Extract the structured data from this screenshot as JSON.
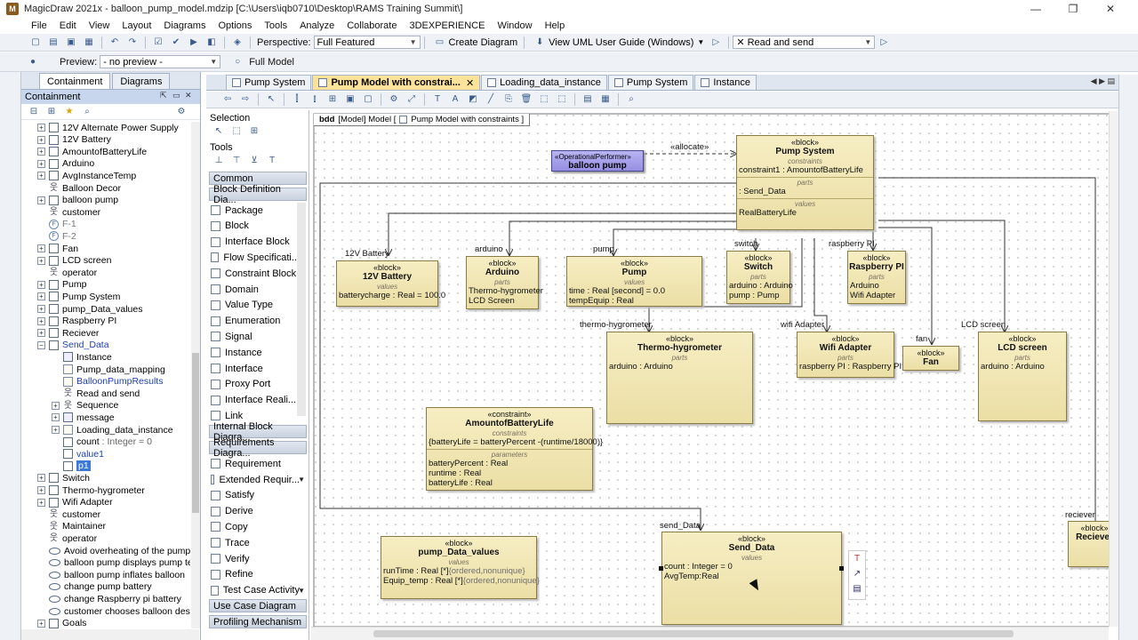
{
  "window": {
    "title": "MagicDraw 2021x - balloon_pump_model.mdzip [C:\\Users\\iqb0710\\Desktop\\RAMS Training Summit\\]",
    "app_icon": "M",
    "controls": [
      "—",
      "❐",
      "✕"
    ]
  },
  "menu": [
    "File",
    "Edit",
    "View",
    "Layout",
    "Diagrams",
    "Options",
    "Tools",
    "Analyze",
    "Collaborate",
    "3DEXPERIENCE",
    "Window",
    "Help"
  ],
  "toolbar": {
    "perspective_label": "Perspective:",
    "perspective_value": "Full Featured",
    "create_diagram": "Create Diagram",
    "uml_guide": "View UML User Guide (Windows)",
    "read_and_send": "Read and send",
    "preview_label": "Preview:",
    "preview_value": "- no preview -",
    "full_model": "Full Model"
  },
  "left_panel": {
    "tabs": [
      "Containment",
      "Diagrams"
    ],
    "header": "Containment",
    "tree": [
      {
        "label": "12V Alternate Power Supply",
        "indent": 1,
        "icon": "block",
        "exp": "+"
      },
      {
        "label": "12V Battery",
        "indent": 1,
        "icon": "block",
        "exp": "+"
      },
      {
        "label": "AmountofBatteryLife",
        "indent": 1,
        "icon": "block",
        "exp": "+"
      },
      {
        "label": "Arduino",
        "indent": 1,
        "icon": "block",
        "exp": "+"
      },
      {
        "label": "AvgInstanceTemp",
        "indent": 1,
        "icon": "block",
        "exp": "+"
      },
      {
        "label": "Balloon Decor",
        "indent": 1,
        "icon": "actor",
        "exp": ""
      },
      {
        "label": "balloon pump",
        "indent": 1,
        "icon": "block",
        "exp": "+"
      },
      {
        "label": "customer",
        "indent": 1,
        "icon": "actor",
        "exp": ""
      },
      {
        "label": "F-1",
        "indent": 1,
        "icon": "fn",
        "exp": "",
        "gray": true
      },
      {
        "label": "F-2",
        "indent": 1,
        "icon": "fn",
        "exp": "",
        "gray": true
      },
      {
        "label": "Fan",
        "indent": 1,
        "icon": "block",
        "exp": "+"
      },
      {
        "label": "LCD screen",
        "indent": 1,
        "icon": "block",
        "exp": "+"
      },
      {
        "label": "operator",
        "indent": 1,
        "icon": "actor",
        "exp": ""
      },
      {
        "label": "Pump",
        "indent": 1,
        "icon": "block",
        "exp": "+"
      },
      {
        "label": "Pump System",
        "indent": 1,
        "icon": "block",
        "exp": "+"
      },
      {
        "label": "pump_Data_values",
        "indent": 1,
        "icon": "block",
        "exp": "+"
      },
      {
        "label": "Raspberry PI",
        "indent": 1,
        "icon": "block",
        "exp": "+"
      },
      {
        "label": "Reciever",
        "indent": 1,
        "icon": "block",
        "exp": "+"
      },
      {
        "label": "Send_Data",
        "indent": 1,
        "icon": "block",
        "exp": "−",
        "link": true
      },
      {
        "label": "Instance",
        "indent": 2,
        "icon": "inst",
        "exp": ""
      },
      {
        "label": "Pump_data_mapping",
        "indent": 2,
        "icon": "diag",
        "exp": ""
      },
      {
        "label": "BalloonPumpResults",
        "indent": 2,
        "icon": "diag",
        "exp": "",
        "link": true
      },
      {
        "label": "Read and send",
        "indent": 2,
        "icon": "actor",
        "exp": ""
      },
      {
        "label": "Sequence",
        "indent": 2,
        "icon": "actor",
        "exp": "+"
      },
      {
        "label": "message",
        "indent": 2,
        "icon": "inst",
        "exp": "+"
      },
      {
        "label": "Loading_data_instance",
        "indent": 2,
        "icon": "diag",
        "exp": "+"
      },
      {
        "label": "count",
        "suffix": " : Integer = 0",
        "indent": 2,
        "icon": "block",
        "exp": ""
      },
      {
        "label": "value1",
        "indent": 2,
        "icon": "block",
        "exp": "",
        "link": true
      },
      {
        "label": "p1",
        "indent": 2,
        "icon": "block",
        "exp": "",
        "selected": true
      },
      {
        "label": "Switch",
        "indent": 1,
        "icon": "block",
        "exp": "+"
      },
      {
        "label": "Thermo-hygrometer",
        "indent": 1,
        "icon": "block",
        "exp": "+"
      },
      {
        "label": "Wifi Adapter",
        "indent": 1,
        "icon": "block",
        "exp": "+"
      },
      {
        "label": "customer",
        "indent": 1,
        "icon": "actor",
        "exp": ""
      },
      {
        "label": "Maintainer",
        "indent": 1,
        "icon": "actor",
        "exp": ""
      },
      {
        "label": "operator",
        "indent": 1,
        "icon": "actor",
        "exp": ""
      },
      {
        "label": "Avoid overheating of the pump",
        "indent": 1,
        "icon": "uc",
        "exp": ""
      },
      {
        "label": "balloon pump displays pump te",
        "indent": 1,
        "icon": "uc",
        "exp": ""
      },
      {
        "label": "balloon pump inflates balloon",
        "indent": 1,
        "icon": "uc",
        "exp": ""
      },
      {
        "label": "change pump battery",
        "indent": 1,
        "icon": "uc",
        "exp": ""
      },
      {
        "label": "change Raspberry pi battery",
        "indent": 1,
        "icon": "uc",
        "exp": ""
      },
      {
        "label": "customer chooses balloon desig",
        "indent": 1,
        "icon": "uc",
        "exp": ""
      },
      {
        "label": "Goals",
        "indent": 1,
        "icon": "block",
        "exp": "+"
      }
    ]
  },
  "palette": {
    "selection": "Selection",
    "tools": "Tools",
    "common": "Common",
    "bdd": "Block Definition Dia...",
    "items": [
      {
        "label": "Package",
        "drop": false
      },
      {
        "label": "Block",
        "drop": false
      },
      {
        "label": "Interface Block",
        "drop": false
      },
      {
        "label": "Flow Specificati...",
        "drop": false
      },
      {
        "label": "Constraint Block",
        "drop": false
      },
      {
        "label": "Domain",
        "drop": true
      },
      {
        "label": "Value Type",
        "drop": true
      },
      {
        "label": "Enumeration",
        "drop": false
      },
      {
        "label": "Signal",
        "drop": false
      },
      {
        "label": "Instance",
        "drop": false
      },
      {
        "label": "Interface",
        "drop": false
      },
      {
        "label": "Proxy Port",
        "drop": true
      },
      {
        "label": "Interface Reali...",
        "drop": true
      },
      {
        "label": "Link",
        "drop": false
      }
    ],
    "ibd": "Internal Block Diagra...",
    "req": "Requirements Diagra...",
    "req_items": [
      {
        "label": "Requirement",
        "drop": false
      },
      {
        "label": "Extended Requir...",
        "drop": true
      },
      {
        "label": "Satisfy",
        "drop": false
      },
      {
        "label": "Derive",
        "drop": false
      },
      {
        "label": "Copy",
        "drop": false
      },
      {
        "label": "Trace",
        "drop": false
      },
      {
        "label": "Verify",
        "drop": false
      },
      {
        "label": "Refine",
        "drop": false
      },
      {
        "label": "Test Case Activity",
        "drop": true
      }
    ],
    "ucd": "Use Case Diagram",
    "profiling": "Profiling Mechanism"
  },
  "editor_tabs": [
    {
      "label": "Pump System",
      "active": false
    },
    {
      "label": "Pump Model with constrai...",
      "active": true
    },
    {
      "label": "Loading_data_instance",
      "active": false
    },
    {
      "label": "Pump System",
      "active": false
    },
    {
      "label": "Instance",
      "active": false
    }
  ],
  "diagram": {
    "frame": {
      "kind": "bdd",
      "text": "[Model] Model [",
      "name": "Pump Model with constraints ]"
    },
    "allocate": "«allocate»",
    "op_performer": {
      "stereo": "«OperationalPerformer»",
      "name": "balloon pump"
    },
    "pump_system": {
      "stereo": "«block»",
      "name": "Pump System",
      "c1": "constraints",
      "constraint": "constraint1 : AmountofBatteryLife",
      "c2": "parts",
      "part": ": Send_Data",
      "c3": "values",
      "value": "RealBatteryLife"
    },
    "battery": {
      "stereo": "«block»",
      "name": "12V Battery",
      "c": "values",
      "row1": "batterycharge : Real = 100.0",
      "role": "12V Battery"
    },
    "arduino": {
      "stereo": "«block»",
      "name": "Arduino",
      "c": "parts",
      "row1": "Thermo-hygrometer",
      "row2": "LCD Screen",
      "role": "arduino"
    },
    "pump": {
      "stereo": "«block»",
      "name": "Pump",
      "c": "values",
      "row1": "time : Real [second] = 0.0",
      "row2": "tempEquip : Real",
      "role": "pump"
    },
    "switch": {
      "stereo": "«block»",
      "name": "Switch",
      "c": "parts",
      "row1": "arduino : Arduino",
      "row2": "pump : Pump",
      "role": "switch"
    },
    "raspberry": {
      "stereo": "«block»",
      "name": "Raspberry PI",
      "c": "parts",
      "row1": "Arduino",
      "row2": "Wifi Adapter",
      "role": "raspberry PI"
    },
    "thermo": {
      "stereo": "«block»",
      "name": "Thermo-hygrometer",
      "c": "parts",
      "row1": "arduino : Arduino",
      "role": "thermo-hygrometer"
    },
    "wifi": {
      "stereo": "«block»",
      "name": "Wifi Adapter",
      "c": "parts",
      "row1": "raspberry PI : Raspberry PI",
      "role": "wifi Adapter"
    },
    "fan": {
      "stereo": "«block»",
      "name": "Fan",
      "role": "fan"
    },
    "lcd": {
      "stereo": "«block»",
      "name": "LCD screen",
      "c": "parts",
      "row1": "arduino : Arduino",
      "role": "LCD screen"
    },
    "constraint": {
      "stereo": "«constraint»",
      "name": "AmountofBatteryLife",
      "c1": "constraints",
      "expr": "{batteryLife = batteryPercent -(runtime/18000)}",
      "c2": "parameters",
      "p1": "batteryPercent : Real",
      "p2": "runtime : Real",
      "p3": "batteryLife : Real"
    },
    "pdv": {
      "stereo": "«block»",
      "name": "pump_Data_values",
      "c": "values",
      "row1": "runTime : Real [*]",
      "row1b": "{ordered,nonunique}",
      "row2": "Equip_temp : Real [*]",
      "row2b": "{ordered,nonunique}"
    },
    "send": {
      "stereo": "«block»",
      "name": "Send_Data",
      "c": "values",
      "row1": "count : Integer = 0",
      "row2": "AvgTemp:Real",
      "role": "send_Data"
    },
    "reciever": {
      "stereo": "«block»",
      "name": "Reciever",
      "role": "reciever"
    }
  }
}
